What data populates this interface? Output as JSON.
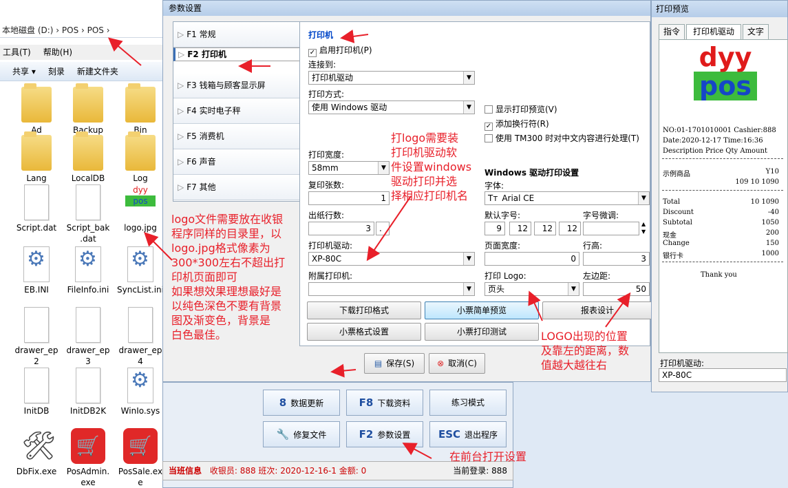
{
  "explorer": {
    "address": "本地磁盘 (D:)  ›  POS  ›  POS  ›",
    "menu": [
      "工具(T)",
      "帮助(H)"
    ],
    "toolbar": [
      "共享 ▾",
      "刻录",
      "新建文件夹"
    ],
    "files": [
      {
        "name": "Ad",
        "kind": "folder"
      },
      {
        "name": "Backup",
        "kind": "folder"
      },
      {
        "name": "Bin",
        "kind": "folder"
      },
      {
        "name": "Lang",
        "kind": "folder"
      },
      {
        "name": "LocalDB",
        "kind": "folder"
      },
      {
        "name": "Log",
        "kind": "folder"
      },
      {
        "name": "Script.dat",
        "kind": "doc"
      },
      {
        "name": "Script_bak\n.dat",
        "kind": "doc"
      },
      {
        "name": "logo.jpg",
        "kind": "logo"
      },
      {
        "name": "EB.INI",
        "kind": "gear"
      },
      {
        "name": "FileInfo.ini",
        "kind": "gear"
      },
      {
        "name": "SyncList.ini",
        "kind": "gear"
      },
      {
        "name": "drawer_ep\n2",
        "kind": "doc"
      },
      {
        "name": "drawer_ep\n3",
        "kind": "doc"
      },
      {
        "name": "drawer_ep\n4",
        "kind": "doc"
      },
      {
        "name": "InitDB",
        "kind": "doc"
      },
      {
        "name": "InitDB2K",
        "kind": "doc"
      },
      {
        "name": "WinIo.sys",
        "kind": "gear"
      },
      {
        "name": "DbFix.exe",
        "kind": "tools"
      },
      {
        "name": "PosAdmin.\nexe",
        "kind": "redapp"
      },
      {
        "name": "PosSale.ex\ne",
        "kind": "redapp"
      }
    ]
  },
  "dialog": {
    "title": "参数设置",
    "nav": [
      {
        "key": "F1",
        "label": "常规"
      },
      {
        "key": "F2",
        "label": "打印机"
      },
      {
        "key": "F3",
        "label": "钱箱与顾客显示屏"
      },
      {
        "key": "F4",
        "label": "实时电子秤"
      },
      {
        "key": "F5",
        "label": "消费机"
      },
      {
        "key": "F6",
        "label": "声音"
      },
      {
        "key": "F7",
        "label": "其他"
      }
    ],
    "printer": {
      "section_title": "打印机",
      "enable_label": "启用打印机(P)",
      "enable_checked": true,
      "connect_label": "连接到:",
      "connect_value": "打印机驱动",
      "mode_label": "打印方式:",
      "mode_value": "使用 Windows 驱动",
      "show_preview_label": "显示打印预览(V)",
      "show_preview_checked": false,
      "add_newline_label": "添加换行符(R)",
      "add_newline_checked": true,
      "tm300_label": "使用 TM300 时对中文内容进行处理(T)",
      "tm300_checked": false,
      "width_label": "打印宽度:",
      "width_value": "58mm",
      "copies_label": "复印张数:",
      "copies_value": "1",
      "feed_label": "出纸行数:",
      "feed_value": "3",
      "feed_extra": ".",
      "driver_label": "打印机驱动:",
      "driver_value": "XP-80C",
      "attached_label": "附属打印机:",
      "attached_value": "",
      "win_section": "Windows 驱动打印设置",
      "font_label": "字体:",
      "font_value": "Arial CE",
      "font_icon": "Tт",
      "default_size_label": "默认字号:",
      "default_sizes": [
        "9",
        "12",
        "12",
        "12"
      ],
      "size_adjust_label": "字号微调:",
      "page_width_label": "页面宽度:",
      "page_width_value": "0",
      "line_height_label": "行高:",
      "line_height_value": "3",
      "logo_label": "打印 Logo:",
      "logo_value": "页头",
      "left_margin_label": "左边距:",
      "left_margin_value": "50"
    },
    "buttons": [
      "下载打印格式",
      "小票简单预览",
      "报表设计",
      "小票格式设置",
      "小票打印测试"
    ],
    "save": "保存(S)",
    "cancel": "取消(C)"
  },
  "main": {
    "buttons": [
      {
        "key": "8",
        "label": "数据更新"
      },
      {
        "key": "F8",
        "label": "下载资料"
      },
      {
        "key": "",
        "label": "练习模式"
      },
      {
        "key": "🔧",
        "label": "修复文件"
      },
      {
        "key": "F2",
        "label": "参数设置"
      },
      {
        "key": "ESC",
        "label": "退出程序"
      }
    ],
    "status_title": "当班信息",
    "status_text": "收银员: 888 班次: 2020-12-16-1 金额: 0",
    "status_login": "当前登录: 888"
  },
  "preview": {
    "title": "打印预览",
    "tabs": [
      "指令",
      "打印机驱动",
      "文字"
    ],
    "logo_top": "dyy",
    "logo_bottom": "pos",
    "receipt": {
      "no_line": "NO:01-1701010001 Cashier:888",
      "date_line": "Date:2020-12-17  Time:16:36",
      "header_line": "Description Price Qty Amount",
      "item_name": "示例商品",
      "item_price": "Y10",
      "item_detail": "109  10   1090",
      "totals": [
        {
          "k": "Total",
          "v": "10    1090"
        },
        {
          "k": "Discount",
          "v": "-40"
        },
        {
          "k": "Subtotal",
          "v": "1050"
        },
        {
          "k": "现金",
          "v": "200"
        },
        {
          "k": "Change",
          "v": "150"
        },
        {
          "k": "银行卡",
          "v": "1000"
        }
      ],
      "thanks": "Thank you"
    },
    "driver_label": "打印机驱动:",
    "driver_value": "XP-80C"
  },
  "annotations": {
    "logo_file": [
      "logo文件需要放在收银",
      "程序同样的目录里，以",
      "logo.jpg格式像素为",
      "300*300左右不超出打",
      "印机页面即可",
      "如果想效果理想最好是",
      "以纯色深色不要有背景",
      "图及渐变色，背景是",
      "白色最佳。"
    ],
    "driver_note": [
      "打logo需要装",
      "打印机驱动软",
      "件设置windows",
      "驱动打印并选",
      "择相应打印机名"
    ],
    "logo_pos": [
      "LOGO出现的位置",
      "及靠左的距离，数",
      "值越大越往右"
    ],
    "open_settings": "在前台打开设置"
  },
  "colors": {
    "annotation": "#e8202a",
    "accent": "#0046c8"
  }
}
